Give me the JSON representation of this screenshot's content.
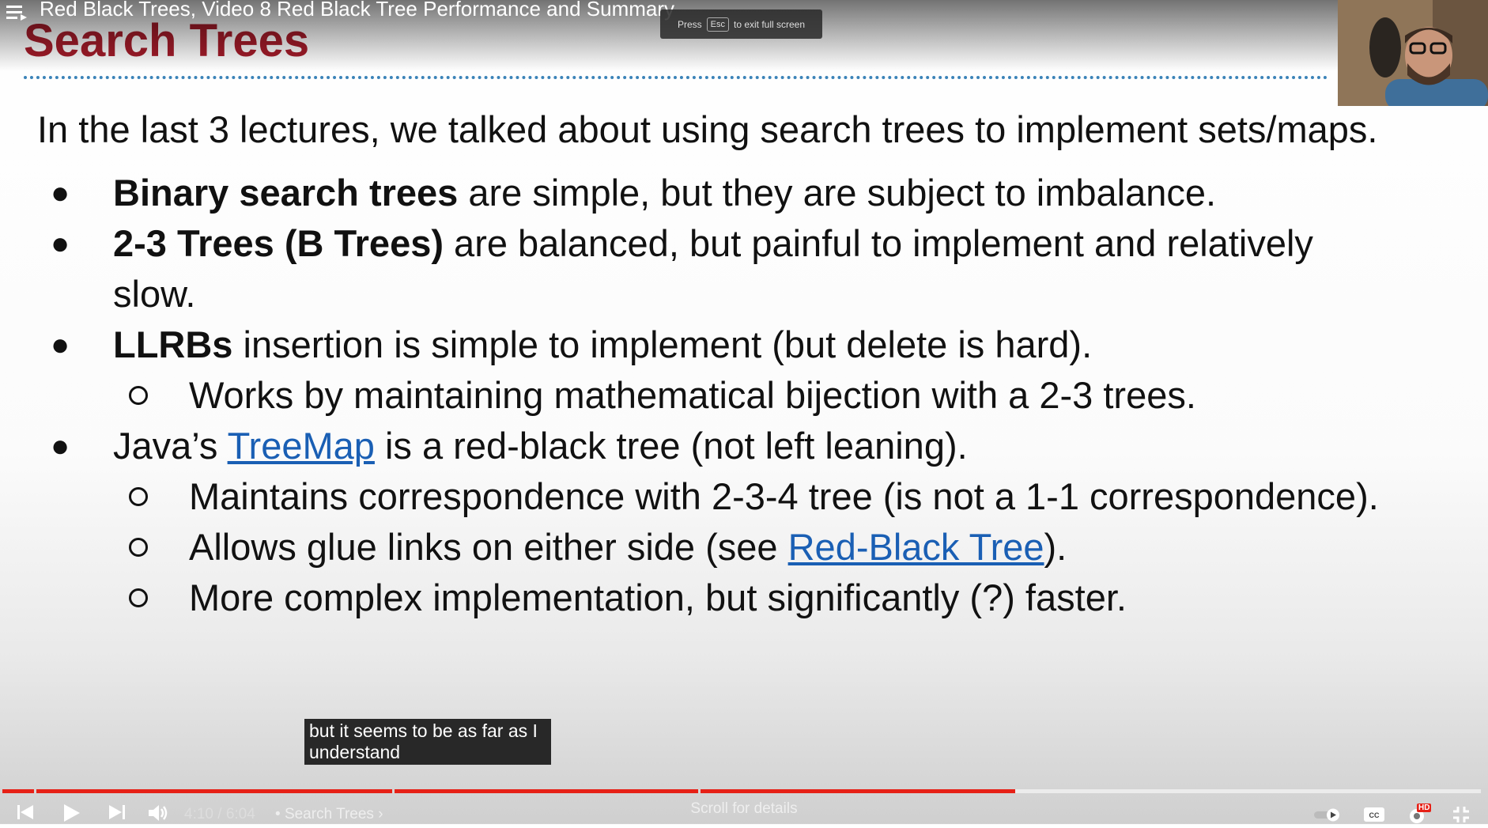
{
  "player": {
    "video_title": "Red Black Trees, Video 8 Red Black Tree Performance and Summary",
    "esc_tip": {
      "prefix": "Press",
      "key": "Esc",
      "suffix": "to exit full screen"
    },
    "time_current": "4:10",
    "time_total": "6:04",
    "time_separator": "/",
    "chapter": "Search Trees",
    "scroll_hint": "Scroll for details",
    "caption": "but it seems to be as far as I understand",
    "progress_fraction": 0.685,
    "hd_badge": "HD",
    "icons": [
      "menu-icon",
      "clock-icon",
      "share-icon",
      "previous-icon",
      "play-icon",
      "next-icon",
      "volume-icon",
      "autoplay-toggle-icon",
      "captions-icon",
      "settings-icon",
      "exit-fullscreen-icon"
    ]
  },
  "slide": {
    "title": "Search Trees",
    "intro": "In the last 3 lectures, we talked about using search trees to implement sets/maps.",
    "b1": {
      "bold": "Binary search trees",
      "rest": " are simple, but they are subject to imbalance."
    },
    "b2": {
      "bold": "2-3 Trees (B Trees)",
      "rest": " are balanced, but painful to implement and relatively",
      "cont": "slow."
    },
    "b3": {
      "bold": "LLRBs",
      "rest": " insertion is simple to implement (but delete is hard)."
    },
    "b3s1": "Works by maintaining mathematical bijection with a 2-3 trees.",
    "b4": {
      "pre": "Java’s ",
      "link": "TreeMap",
      "rest": " is a red-black tree (not left leaning)."
    },
    "b4s1": "Maintains correspondence with 2-3-4 tree (is not a 1-1 correspondence).",
    "b4s2": {
      "pre": "Allows glue links on either side (see ",
      "link": "Red-Black Tree",
      "post": ")."
    },
    "b4s3": "More complex implementation, but significantly (?) faster."
  },
  "colors": {
    "title": "#a61c2a",
    "link": "#1a5fb4",
    "progress": "#e62117",
    "rule": "#3b83b8"
  }
}
